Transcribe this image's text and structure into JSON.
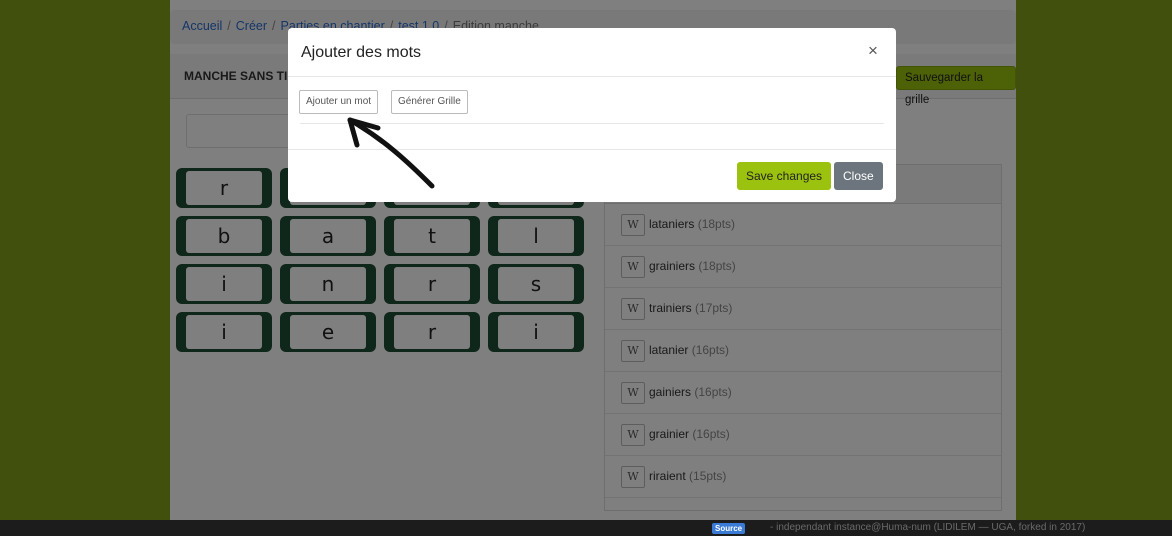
{
  "breadcrumb": {
    "items": [
      "Accueil",
      "Créer",
      "Parties en chantier",
      "test 1.0"
    ],
    "current": "Edition manche",
    "sep": "/"
  },
  "panel": {
    "title": "MANCHE SANS TI",
    "save_grid_label": "Sauvegarder la grille"
  },
  "grid": {
    "rows": [
      [
        "r",
        "",
        "",
        ""
      ],
      [
        "b",
        "a",
        "t",
        "l"
      ],
      [
        "i",
        "n",
        "r",
        "s"
      ],
      [
        "i",
        "e",
        "r",
        "i"
      ]
    ]
  },
  "words": [
    {
      "btn": "W",
      "word": "lataniers",
      "pts": "(18pts)"
    },
    {
      "btn": "W",
      "word": "grainiers",
      "pts": "(18pts)"
    },
    {
      "btn": "W",
      "word": "trainiers",
      "pts": "(17pts)"
    },
    {
      "btn": "W",
      "word": "latanier",
      "pts": "(16pts)"
    },
    {
      "btn": "W",
      "word": "gainiers",
      "pts": "(16pts)"
    },
    {
      "btn": "W",
      "word": "grainier",
      "pts": "(16pts)"
    },
    {
      "btn": "W",
      "word": "riraient",
      "pts": "(15pts)"
    }
  ],
  "modal": {
    "title": "Ajouter des mots",
    "close_symbol": "×",
    "add_word_label": "Ajouter un mot",
    "generate_grid_label": "Générer Grille",
    "save_changes_label": "Save changes",
    "close_label": "Close"
  },
  "footer": {
    "source_label": "Source",
    "credit": "- independant instance@Huma-num (LIDILEM — UGA, forked in 2017)"
  },
  "colors": {
    "page_bg": "#82a11a",
    "accent": "#9bc20e",
    "tile_border": "#1f4d37",
    "close_btn": "#6c757d",
    "link": "#2a6bd0"
  }
}
